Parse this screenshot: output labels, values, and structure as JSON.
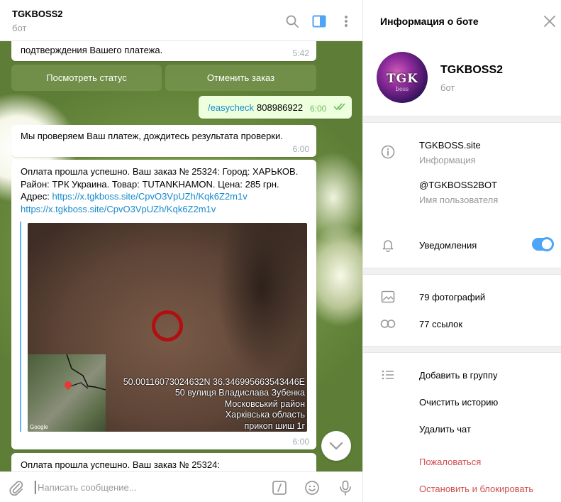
{
  "chat": {
    "title": "TGKBOSS2",
    "subtitle": "бот",
    "messages": {
      "m1_text": "подтверждения Вашего платежа.",
      "m1_time": "5:42",
      "btn_status": "Посмотреть статус",
      "btn_cancel": "Отменить заказ",
      "out_command": "/easycheck",
      "out_number": "808986922",
      "out_time": "6:00",
      "m2_text": "Мы проверяем Ваш платеж, дождитесь результата проверки.",
      "m2_time": "6:00",
      "m3_line1": "Оплата прошла успешно. Ваш заказ № 25324: Город: ХАРЬКОВ.",
      "m3_line2": "Район: ТРК Украина. Товар: TUTANKHAMON. Цена: 285 грн.",
      "m3_line3_prefix": "Адрес: ",
      "m3_link1": "https://x.tgkboss.site/CpvO3VpUZh/Kqk6Z2m1v",
      "m3_link2": "https://x.tgkboss.site/CpvO3VpUZh/Kqk6Z2m1v",
      "m3_time": "6:00",
      "photo_caption": [
        "50.00116073024632N 36.346995663543446E",
        "50 вулиця Владислава Зубенка",
        "Московський район",
        "Харківська область",
        "прикоп шиш 1г"
      ],
      "map_logo": "Google",
      "m4_text": "Оплата прошла успешно. Ваш заказ № 25324:"
    },
    "composer": {
      "placeholder": "Написать сообщение..."
    }
  },
  "panel": {
    "title": "Информация о боте",
    "avatar_logo": "TGK",
    "avatar_logo_sub": "boss",
    "name": "TGKBOSS2",
    "role": "бот",
    "site": "TGKBOSS.site",
    "site_label": "Информация",
    "username": "@TGKBOSS2BOT",
    "username_label": "Имя пользователя",
    "notifications": "Уведомления",
    "notifications_enabled": true,
    "photos": "79 фотографий",
    "links": "77 ссылок",
    "add_to_group": "Добавить в группу",
    "clear_history": "Очистить историю",
    "delete_chat": "Удалить чат",
    "report": "Пожаловаться",
    "stop_block": "Остановить и блокировать"
  },
  "colors": {
    "accent": "#4ea4f6",
    "link": "#168acd",
    "danger": "#d14e4e",
    "outgoing": "#eeffde"
  }
}
